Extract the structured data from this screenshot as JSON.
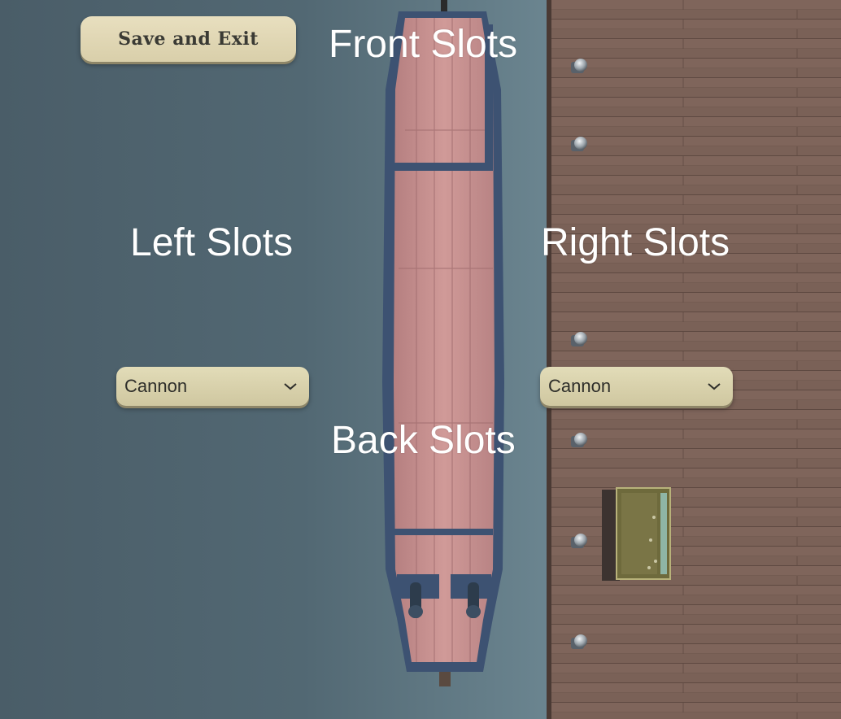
{
  "ui": {
    "save_exit_label": "Save and Exit",
    "slot_labels": {
      "front": "Front Slots",
      "left": "Left Slots",
      "right": "Right Slots",
      "back": "Back Slots"
    },
    "left_slot_select": {
      "value": "Cannon"
    },
    "right_slot_select": {
      "value": "Cannon"
    }
  },
  "icons": {
    "dropdown": "chevron-down-icon"
  },
  "colors": {
    "water": "#4c5f6a",
    "dock": "#7b6257",
    "parchment": "#ddd4b0",
    "hull": "#3f5576",
    "deck": "#c98e8e"
  }
}
